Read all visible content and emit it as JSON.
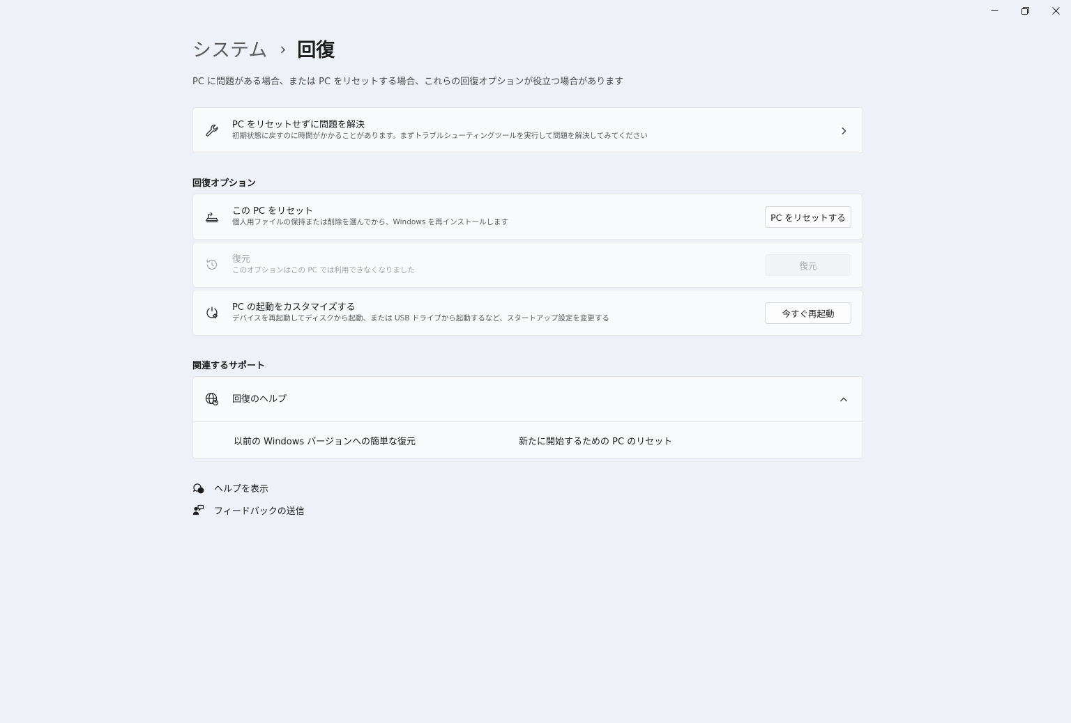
{
  "window": {
    "controls": [
      "minimize-icon",
      "restore-icon",
      "close-icon"
    ]
  },
  "breadcrumb": {
    "parent": "システム",
    "current": "回復"
  },
  "description": "PC に問題がある場合、または PC をリセットする場合、これらの回復オプションが役立つ場合があります",
  "troubleshoot": {
    "icon": "wrench-icon",
    "title": "PC をリセットせずに問題を解決",
    "subtitle": "初期状態に戻すのに時間がかかることがあります。まずトラブルシューティングツールを実行して問題を解決してみてください"
  },
  "recovery_options": {
    "heading": "回復オプション",
    "items": [
      {
        "icon": "reset-pc-icon",
        "title": "この PC をリセット",
        "subtitle": "個人用ファイルの保持または削除を選んでから、Windows を再インストールします",
        "button": "PC をリセットする",
        "enabled": true
      },
      {
        "icon": "history-icon",
        "title": "復元",
        "subtitle": "このオプションはこの PC では利用できなくなりました",
        "button": "復元",
        "enabled": false
      },
      {
        "icon": "advanced-startup-icon",
        "title": "PC の起動をカスタマイズする",
        "subtitle": "デバイスを再起動してディスクから起動、または USB ドライブから起動するなど、スタートアップ設定を変更する",
        "button": "今すぐ再起動",
        "enabled": true
      }
    ]
  },
  "related_support": {
    "heading": "関連するサポート",
    "help": {
      "icon": "globe-help-icon",
      "title": "回復のヘルプ",
      "expanded": true,
      "links": [
        "以前の Windows バージョンへの簡単な復元",
        "新たに開始するための PC のリセット"
      ]
    }
  },
  "footer": {
    "get_help": "ヘルプを表示",
    "feedback": "フィードバックの送信"
  }
}
